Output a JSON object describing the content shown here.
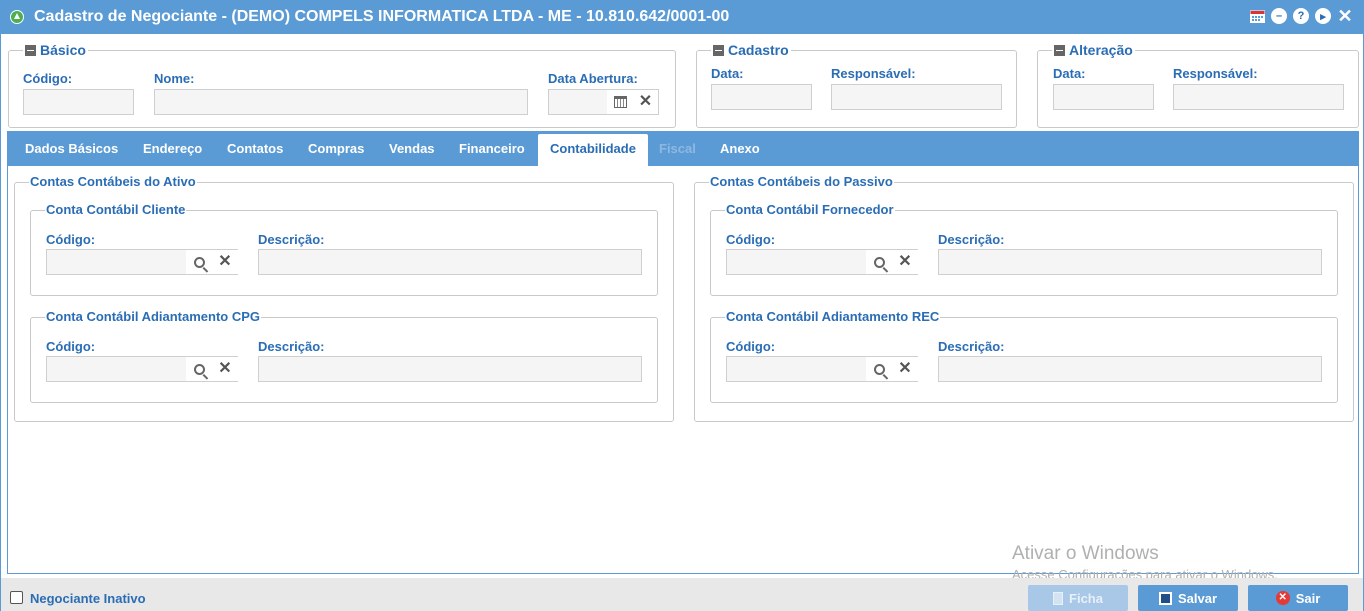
{
  "window": {
    "title": "Cadastro de Negociante - (DEMO) COMPELS INFORMATICA LTDA - ME - 10.810.642/0001-00",
    "icons": [
      "calendar-icon",
      "minimize-icon",
      "help-icon",
      "next-icon",
      "close-icon"
    ]
  },
  "basico": {
    "legend": "Básico",
    "codigo_label": "Código:",
    "codigo_value": "",
    "nome_label": "Nome:",
    "nome_value": "",
    "data_abertura_label": "Data Abertura:",
    "data_abertura_value": ""
  },
  "cadastro": {
    "legend": "Cadastro",
    "data_label": "Data:",
    "responsavel_label": "Responsável:"
  },
  "alteracao": {
    "legend": "Alteração",
    "data_label": "Data:",
    "responsavel_label": "Responsável:"
  },
  "tabs": [
    {
      "label": "Dados Básicos",
      "state": "normal"
    },
    {
      "label": "Endereço",
      "state": "normal"
    },
    {
      "label": "Contatos",
      "state": "normal"
    },
    {
      "label": "Compras",
      "state": "normal"
    },
    {
      "label": "Vendas",
      "state": "normal"
    },
    {
      "label": "Financeiro",
      "state": "normal"
    },
    {
      "label": "Contabilidade",
      "state": "active"
    },
    {
      "label": "Fiscal",
      "state": "disabled"
    },
    {
      "label": "Anexo",
      "state": "normal"
    }
  ],
  "ativo": {
    "legend": "Contas Contábeis do Ativo",
    "cliente": {
      "legend": "Conta Contábil Cliente",
      "codigo_label": "Código:",
      "descricao_label": "Descrição:"
    },
    "adiantamento": {
      "legend": "Conta Contábil Adiantamento CPG",
      "codigo_label": "Código:",
      "descricao_label": "Descrição:"
    }
  },
  "passivo": {
    "legend": "Contas Contábeis do Passivo",
    "fornecedor": {
      "legend": "Conta Contábil Fornecedor",
      "codigo_label": "Código:",
      "descricao_label": "Descrição:"
    },
    "adiantamento": {
      "legend": "Conta Contábil Adiantamento REC",
      "codigo_label": "Código:",
      "descricao_label": "Descrição:"
    }
  },
  "footer": {
    "inativo_label": "Negociante Inativo",
    "inativo_checked": false,
    "ficha_label": "Ficha",
    "salvar_label": "Salvar",
    "sair_label": "Sair"
  },
  "watermark": {
    "line1": "Ativar o Windows",
    "line2": "Acesse Configurações para ativar o Windows."
  },
  "colors": {
    "accent": "#5b9bd5",
    "label": "#2a6db5",
    "exit_red": "#e53935"
  }
}
